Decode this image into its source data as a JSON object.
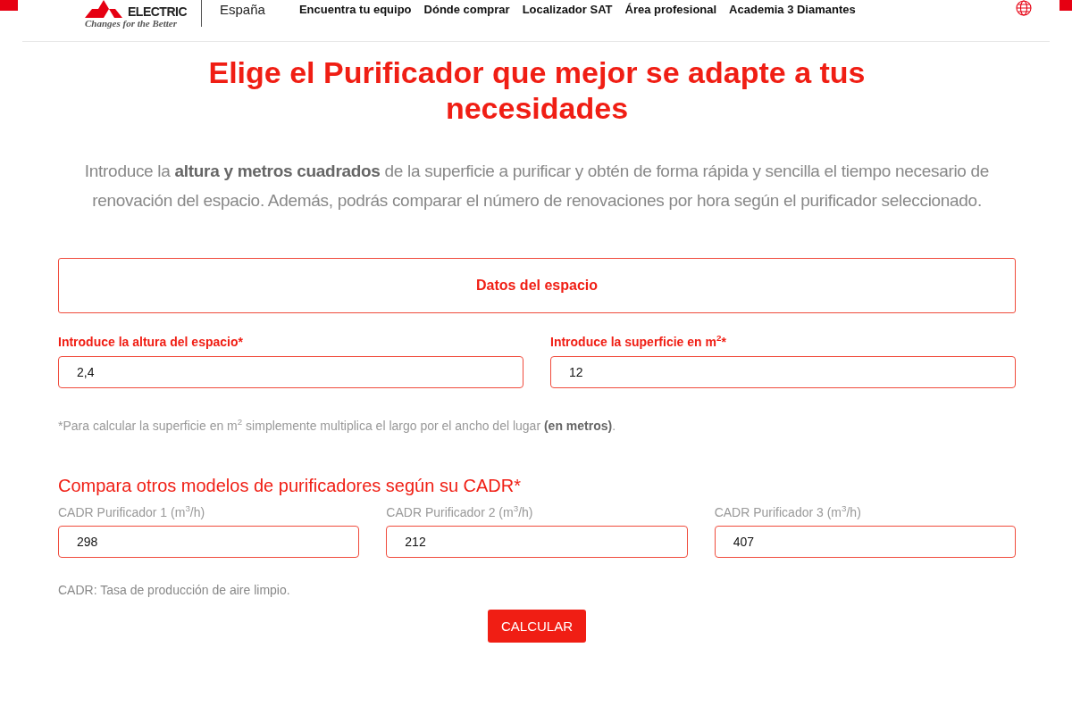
{
  "header": {
    "logo_wordmark": "ELECTRIC",
    "logo_tagline": "Changes for the Better",
    "country": "España",
    "nav": [
      "Encuentra tu equipo",
      "Dónde comprar",
      "Localizador SAT",
      "Área profesional",
      "Academia 3 Diamantes"
    ]
  },
  "title": "Elige el Purificador que mejor se adapte a tus necesidades",
  "intro": "Introduce la **altura y metros cuadrados** de la superficie a purificar y obtén de forma rápida y sencilla el tiempo necesario de renovación del espacio. Además, podrás comparar el número de renovaciones por hora según el purificador seleccionado.",
  "section_title": "Datos del espacio",
  "space_fields": [
    {
      "label": "Introduce la altura del espacio*",
      "value": "2,4"
    },
    {
      "label": "Introduce la superficie en m$^{2}$*",
      "value": "12"
    }
  ],
  "footnote": "*Para calcular la superficie en m$^{2}$ simplemente multiplica el largo por el ancho del lugar **(en metros)**.",
  "compare_title": "Compara otros modelos de purificadores según su CADR*",
  "cadr_fields": [
    {
      "label": "CADR Purificador 1 (m$^{3}$/h)",
      "value": "298"
    },
    {
      "label": "CADR Purificador 2 (m$^{3}$/h)",
      "value": "212"
    },
    {
      "label": "CADR Purificador 3 (m$^{3}$/h)",
      "value": "407"
    }
  ],
  "cadr_note": "CADR: Tasa de producción de aire limpio.",
  "button": "CALCULAR"
}
